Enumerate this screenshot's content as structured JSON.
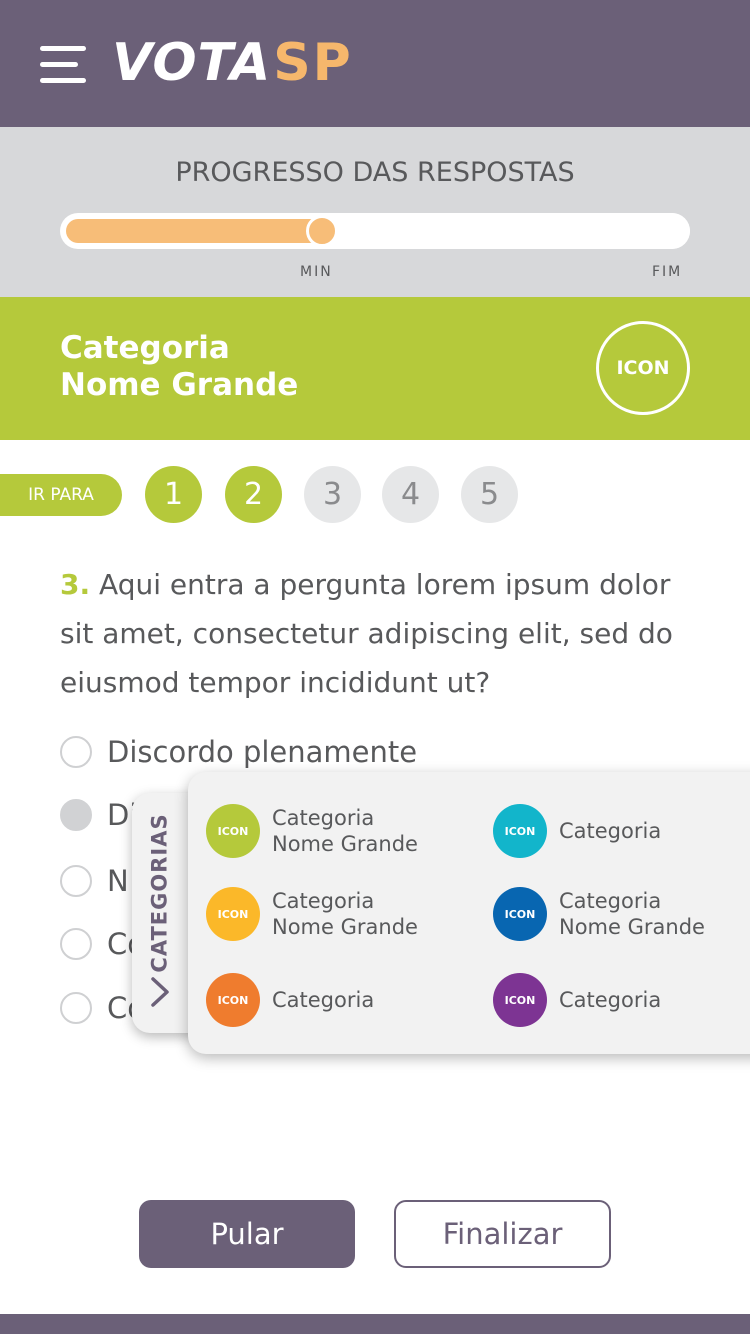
{
  "header": {
    "logo_part1": "VOTA",
    "logo_part2": "SP",
    "menu_icon": "hamburger-menu-icon"
  },
  "progress": {
    "title": "PROGRESSO DAS RESPOSTAS",
    "min_label": "MIN",
    "end_label": "FIM",
    "fraction": 0.41
  },
  "category": {
    "title_line1": "Categoria",
    "title_line2": "Nome Grande",
    "icon_label": "ICON",
    "color": "#b5c93b"
  },
  "navigation": {
    "goto_label": "IR PARA",
    "steps": [
      {
        "label": "1",
        "state": "done"
      },
      {
        "label": "2",
        "state": "done"
      },
      {
        "label": "3",
        "state": "todo"
      },
      {
        "label": "4",
        "state": "todo"
      },
      {
        "label": "5",
        "state": "todo"
      }
    ]
  },
  "question": {
    "number": "3.",
    "text": "Aqui entra a pergunta lorem ipsum dolor sit amet, consectetur adipiscing elit, sed do eiusmod tempor incididunt ut?"
  },
  "options": [
    {
      "label": "Discordo plenamente",
      "selected": false
    },
    {
      "label": "Di",
      "selected": true
    },
    {
      "label": "N",
      "selected": false
    },
    {
      "label": "Co",
      "selected": false
    },
    {
      "label": "Co",
      "selected": false
    }
  ],
  "categories_panel": {
    "tab_label": "CATEGORIAS",
    "items": [
      {
        "line1": "Categoria",
        "line2": "Nome Grande",
        "icon": "ICON",
        "color": "#b5c93b"
      },
      {
        "line1": "Categoria",
        "line2": "",
        "icon": "ICON",
        "color": "#12b5cb"
      },
      {
        "line1": "Categoria",
        "line2": "Nome Grande",
        "icon": "ICON",
        "color": "#fbb829"
      },
      {
        "line1": "Categoria",
        "line2": "Nome Grande",
        "icon": "ICON",
        "color": "#0866b1"
      },
      {
        "line1": "Categoria",
        "line2": "",
        "icon": "ICON",
        "color": "#ef7c2e"
      },
      {
        "line1": "Categoria",
        "line2": "",
        "icon": "ICON",
        "color": "#7d3493"
      }
    ]
  },
  "buttons": {
    "skip": "Pular",
    "finish": "Finalizar"
  },
  "colors": {
    "primary": "#6b6078",
    "accent": "#b5c93b",
    "progress": "#f7bd78"
  }
}
